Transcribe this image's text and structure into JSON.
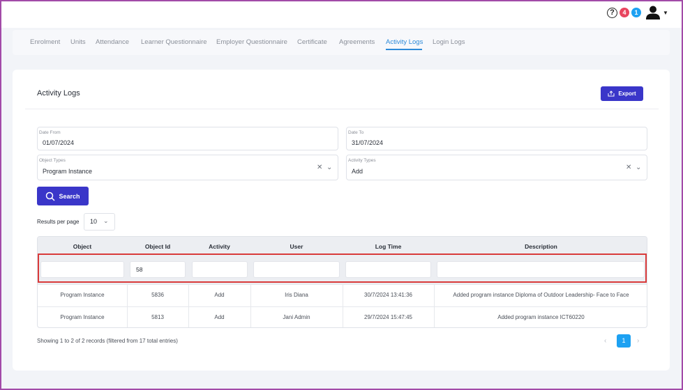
{
  "header": {
    "help_glyph": "?",
    "badge_red": "4",
    "badge_blue": "1",
    "colors": {
      "badge_red": "#e8455f",
      "badge_blue": "#1da1f2"
    }
  },
  "tabs": [
    {
      "label": "Enrolment",
      "active": false
    },
    {
      "label": "Units",
      "active": false
    },
    {
      "label": "Attendance",
      "active": false
    },
    {
      "label": "Learner Questionnaire",
      "active": false
    },
    {
      "label": "Employer Questionnaire",
      "active": false
    },
    {
      "label": "Certificate",
      "active": false
    },
    {
      "label": "Agreements",
      "active": false
    },
    {
      "label": "Activity Logs",
      "active": true
    },
    {
      "label": "Login Logs",
      "active": false
    }
  ],
  "page": {
    "title": "Activity Logs",
    "export_label": "Export"
  },
  "filters": {
    "date_from": {
      "label": "Date From",
      "value": "01/07/2024"
    },
    "date_to": {
      "label": "Date To",
      "value": "31/07/2024"
    },
    "object_types": {
      "label": "Object Types",
      "value": "Program Instance"
    },
    "activity_types": {
      "label": "Activity Types",
      "value": "Add"
    },
    "search_label": "Search"
  },
  "pagination": {
    "rpp_label": "Results per page",
    "rpp_value": "10",
    "summary": "Showing 1 to 2 of 2 records (filtered from 17 total entries)",
    "current_page": "1"
  },
  "table": {
    "columns": [
      "Object",
      "Object Id",
      "Activity",
      "User",
      "Log Time",
      "Description"
    ],
    "filter_values": [
      "",
      "58",
      "",
      "",
      "",
      ""
    ],
    "rows": [
      [
        "Program Instance",
        "5836",
        "Add",
        "Iris Diana",
        "30/7/2024 13:41:36",
        "Added program instance Diploma of Outdoor Leadership- Face to Face"
      ],
      [
        "Program Instance",
        "5813",
        "Add",
        "Jani Admin",
        "29/7/2024 15:47:45",
        "Added program instance ICT60220"
      ]
    ]
  },
  "accent_colors": {
    "primary": "#3a36c9",
    "tab_active": "#2c8ad8",
    "highlight": "#d93a3a"
  }
}
